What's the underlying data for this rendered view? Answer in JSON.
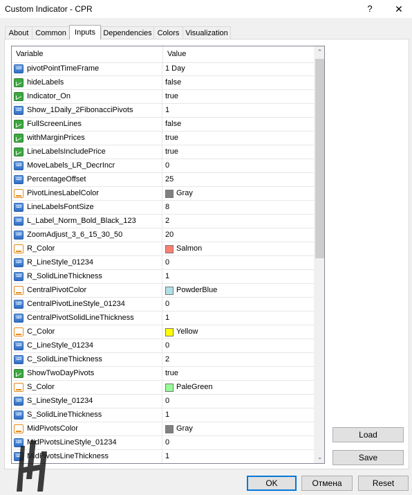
{
  "window": {
    "title": "Custom Indicator - CPR",
    "help_label": "?",
    "close_label": "✕"
  },
  "tabs": [
    {
      "label": "About"
    },
    {
      "label": "Common"
    },
    {
      "label": "Inputs",
      "active": true
    },
    {
      "label": "Dependencies"
    },
    {
      "label": "Colors"
    },
    {
      "label": "Visualization"
    }
  ],
  "grid": {
    "columns": {
      "variable": "Variable",
      "value": "Value"
    },
    "rows": [
      {
        "name": "pivotPointTimeFrame",
        "type": "num",
        "value": "1 Day"
      },
      {
        "name": "hideLabels",
        "type": "bool",
        "value": "false"
      },
      {
        "name": "Indicator_On",
        "type": "bool",
        "value": "true"
      },
      {
        "name": "Show_1Daily_2FibonacciPivots",
        "type": "num",
        "value": "1"
      },
      {
        "name": "FullScreenLines",
        "type": "bool",
        "value": "false"
      },
      {
        "name": "withMarginPrices",
        "type": "bool",
        "value": "true"
      },
      {
        "name": "LineLabelsIncludePrice",
        "type": "bool",
        "value": "true"
      },
      {
        "name": "MoveLabels_LR_DecrIncr",
        "type": "num",
        "value": "0"
      },
      {
        "name": "PercentageOffset",
        "type": "num",
        "value": "25"
      },
      {
        "name": "PivotLinesLabelColor",
        "type": "color",
        "value": "Gray",
        "swatch": "#808080"
      },
      {
        "name": "LineLabelsFontSize",
        "type": "num",
        "value": "8"
      },
      {
        "name": "L_Label_Norm_Bold_Black_123",
        "type": "num",
        "value": "2"
      },
      {
        "name": "ZoomAdjust_3_6_15_30_50",
        "type": "num",
        "value": "20"
      },
      {
        "name": "R_Color",
        "type": "color",
        "value": "Salmon",
        "swatch": "#fa8072"
      },
      {
        "name": "R_LineStyle_01234",
        "type": "num",
        "value": "0"
      },
      {
        "name": "R_SolidLineThickness",
        "type": "num",
        "value": "1"
      },
      {
        "name": "CentralPivotColor",
        "type": "color",
        "value": "PowderBlue",
        "swatch": "#b0e0e6"
      },
      {
        "name": "CentralPivotLineStyle_01234",
        "type": "num",
        "value": "0"
      },
      {
        "name": "CentralPivotSolidLineThickness",
        "type": "num",
        "value": "1"
      },
      {
        "name": "C_Color",
        "type": "color",
        "value": "Yellow",
        "swatch": "#ffff00"
      },
      {
        "name": "C_LineStyle_01234",
        "type": "num",
        "value": "0"
      },
      {
        "name": "C_SolidLineThickness",
        "type": "num",
        "value": "2"
      },
      {
        "name": "ShowTwoDayPivots",
        "type": "bool",
        "value": "true"
      },
      {
        "name": "S_Color",
        "type": "color",
        "value": "PaleGreen",
        "swatch": "#98fb98"
      },
      {
        "name": "S_LineStyle_01234",
        "type": "num",
        "value": "0"
      },
      {
        "name": "S_SolidLineThickness",
        "type": "num",
        "value": "1"
      },
      {
        "name": "MidPivotsColor",
        "type": "color",
        "value": "Gray",
        "swatch": "#808080"
      },
      {
        "name": "MidPivotsLineStyle_01234",
        "type": "num",
        "value": "0"
      },
      {
        "name": "MidPivotsLineThickness",
        "type": "num",
        "value": "1"
      }
    ],
    "scroll_up": "⌃",
    "scroll_down": "⌄"
  },
  "side_buttons": {
    "load": "Load",
    "save": "Save"
  },
  "footer": {
    "ok": "OK",
    "cancel": "Отмена",
    "reset": "Reset"
  },
  "icon_text": {
    "num": "123"
  }
}
